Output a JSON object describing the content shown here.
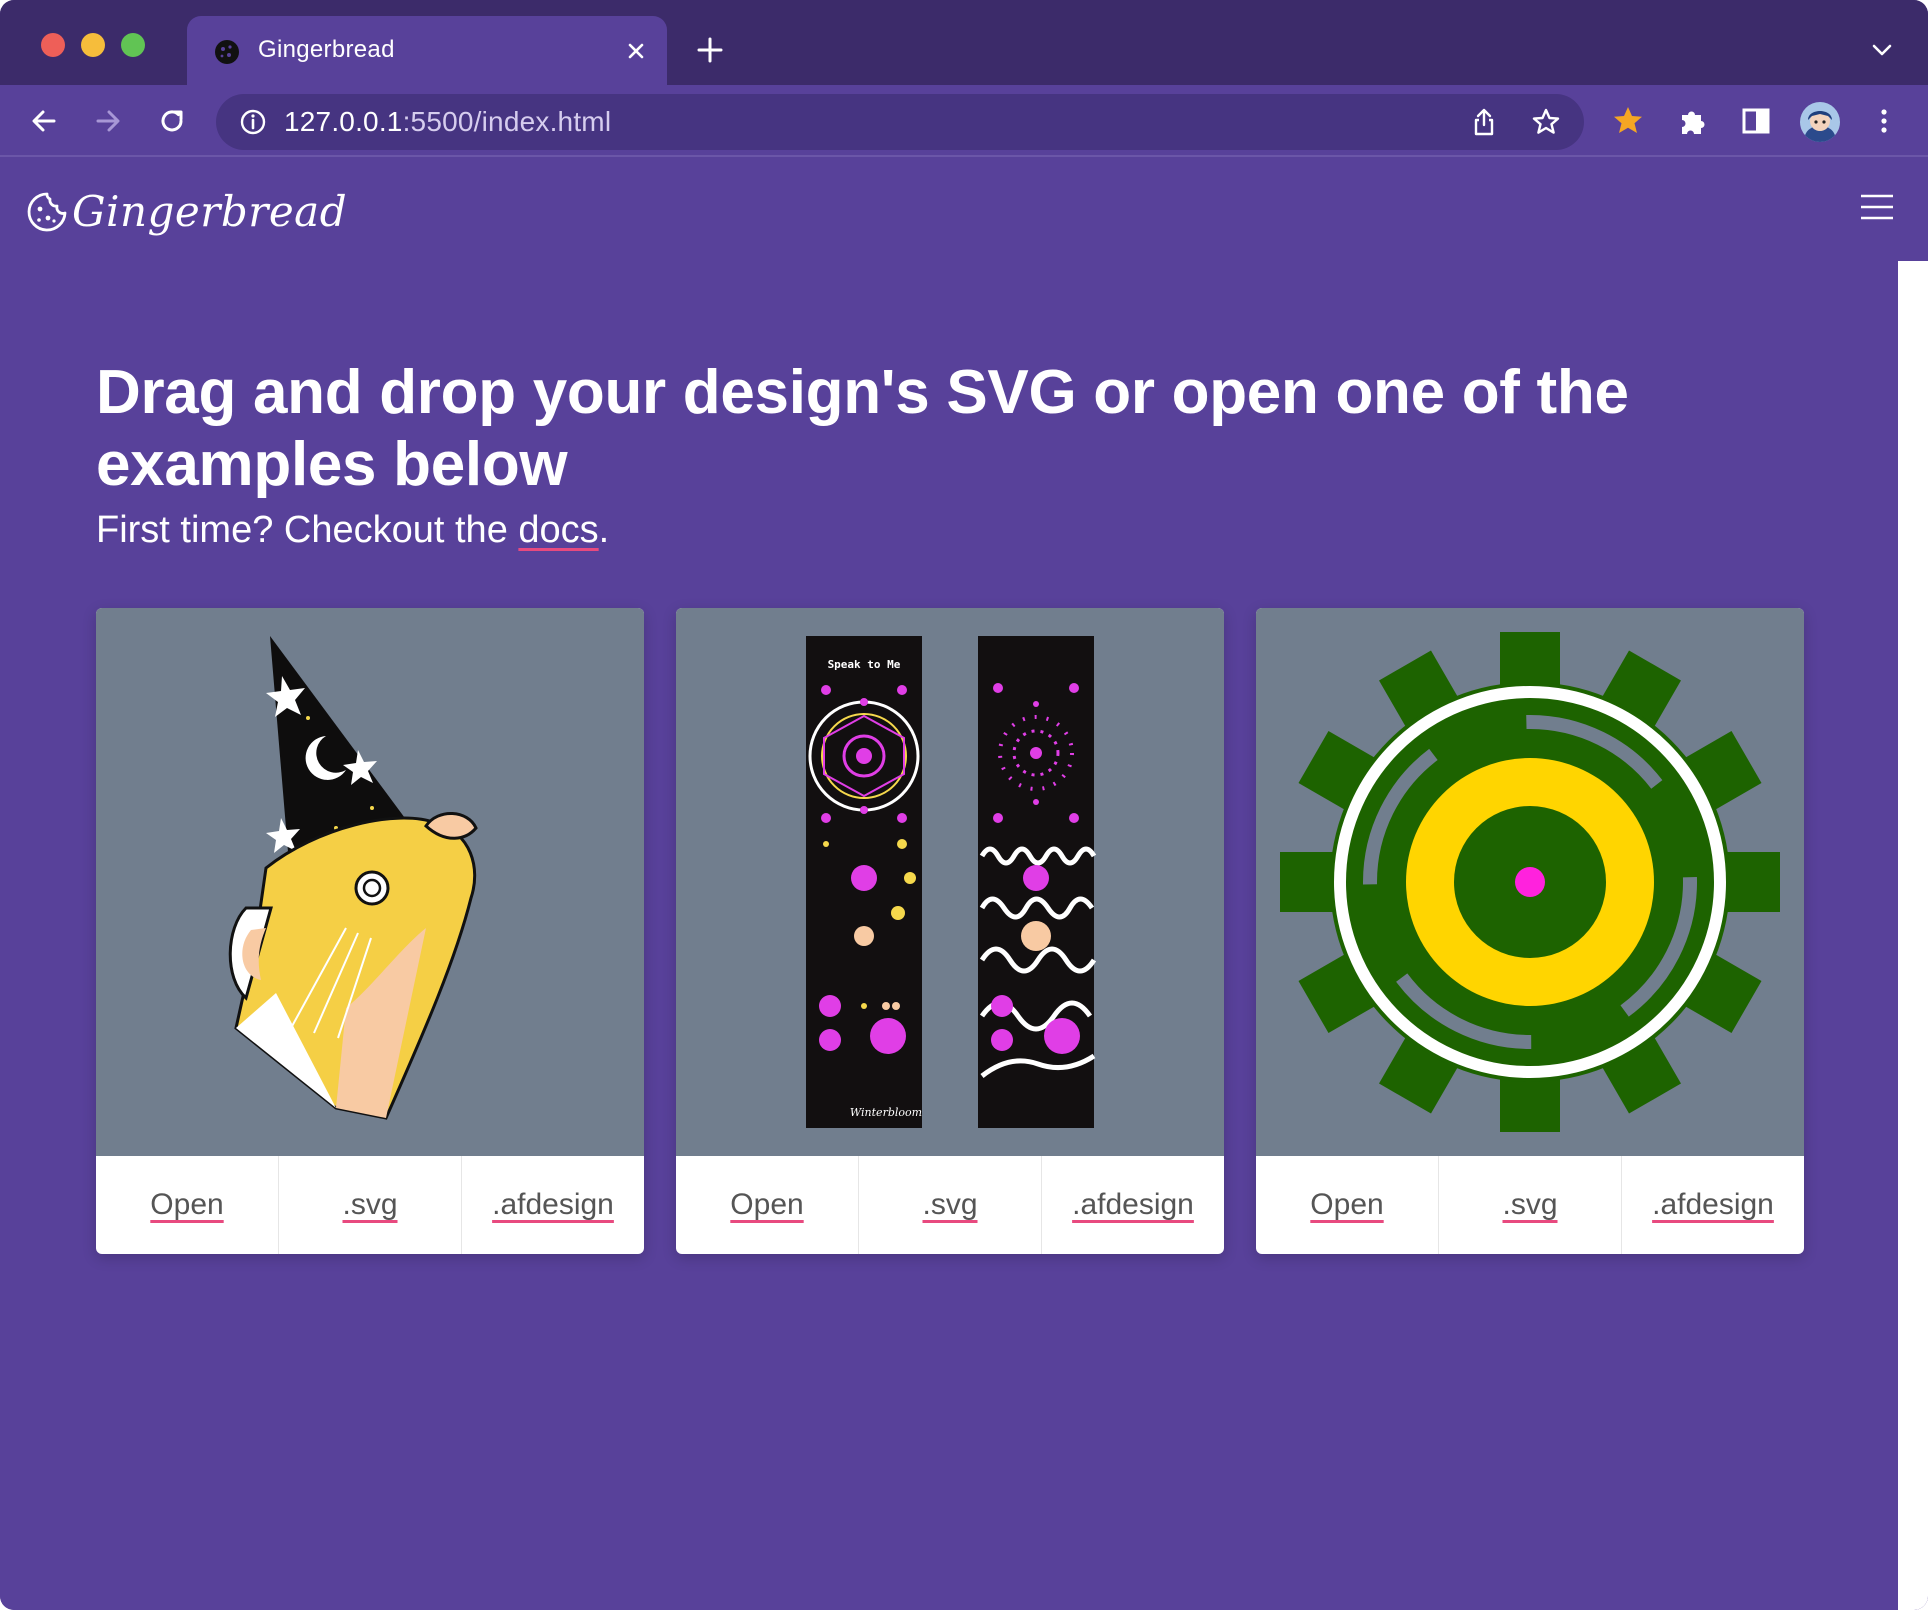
{
  "browser": {
    "tab_title": "Gingerbread",
    "url_host": "127.0.0.1",
    "url_rest": ":5500/index.html"
  },
  "navbar": {
    "brand": "Gingerbread"
  },
  "hero": {
    "headline": "Drag and drop your design's SVG or open one of the examples below",
    "sub_prefix": "First time? Checkout the ",
    "sub_link": "docs",
    "sub_suffix": "."
  },
  "examples": [
    {
      "actions": [
        "Open",
        ".svg",
        ".afdesign"
      ]
    },
    {
      "actions": [
        "Open",
        ".svg",
        ".afdesign"
      ],
      "art_text": "Speak to Me",
      "art_signature": "Winterbloom"
    },
    {
      "actions": [
        "Open",
        ".svg",
        ".afdesign"
      ]
    }
  ],
  "colors": {
    "page_bg": "#58419a",
    "tabstrip_bg": "#3c2b6a",
    "card_image_bg": "#717e8e",
    "link_underline": "#e84a7f"
  }
}
